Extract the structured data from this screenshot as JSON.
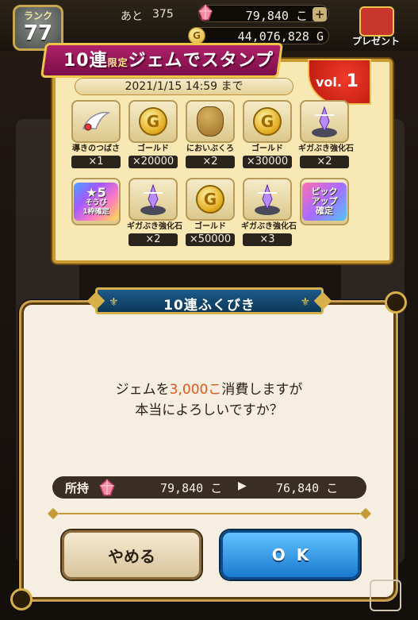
{
  "hud": {
    "rank_label": "ランク",
    "rank_value": "77",
    "remain_label": "あと",
    "remain_value": "375",
    "gems": "79,840 こ",
    "gems_plus": "+",
    "gold": "44,076,828 G",
    "gold_coin": "G",
    "present_label": "プレゼント"
  },
  "stamp_card": {
    "banner_prefix": "10連",
    "banner_small": "限定",
    "banner_text": "ジェムでスタンプ",
    "vol_label": "vol.",
    "vol_number": "1",
    "deadline": "2021/1/15 14:59 まで",
    "stamps": [
      {
        "name": "導きのつばさ",
        "qty": "×1",
        "icon": "wing-icon"
      },
      {
        "name": "ゴールド",
        "qty": "×20000",
        "icon": "gold-coin-icon",
        "glyph": "G"
      },
      {
        "name": "においぶくろ",
        "qty": "×2",
        "icon": "scent-bag-icon"
      },
      {
        "name": "ゴールド",
        "qty": "×30000",
        "icon": "gold-coin-icon",
        "glyph": "G"
      },
      {
        "name": "ギガぶき強化石",
        "qty": "×2",
        "icon": "giga-crystal-icon"
      },
      {
        "name": "",
        "qty": "",
        "icon": "star5-ticket-icon",
        "line1": "★5",
        "line2": "そうび",
        "line3": "1枠確定"
      },
      {
        "name": "ギガぶき強化石",
        "qty": "×2",
        "icon": "giga-crystal-icon"
      },
      {
        "name": "ゴールド",
        "qty": "×50000",
        "icon": "gold-coin-icon",
        "glyph": "G"
      },
      {
        "name": "ギガぶき強化石",
        "qty": "×3",
        "icon": "giga-crystal-icon"
      },
      {
        "name": "",
        "qty": "",
        "icon": "pickup-ticket-icon",
        "line1": "ピック",
        "line2": "アップ",
        "line3": "確定"
      }
    ]
  },
  "dialog": {
    "title": "10連ふくびき",
    "message_pre": "ジェムを",
    "message_cost": "3,000こ",
    "message_post": "消費しますが",
    "message_line2": "本当によろしいですか？",
    "owned_label": "所持",
    "owned_before": "79,840 こ",
    "owned_after": "76,840 こ",
    "cancel_label": "やめる",
    "ok_label": "OK"
  },
  "colors": {
    "accent_gold": "#c99a2e",
    "ok_blue": "#1a7ad0",
    "highlight_orange": "#e0561c",
    "banner_magenta": "#b0226a"
  }
}
